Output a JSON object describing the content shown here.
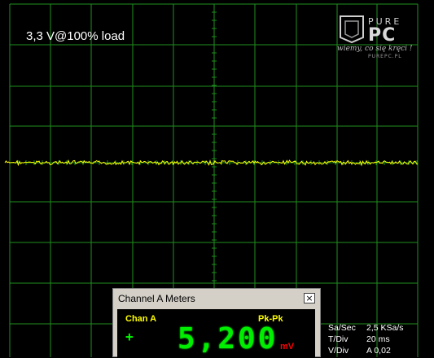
{
  "scope": {
    "grid_color": "#1f8f1f",
    "trace_color": "#ffff00",
    "background": "#000000",
    "overlay_label": "3,3 V@100% load"
  },
  "logo": {
    "word": "PURE",
    "brand": "PC",
    "slogan": "wiemy, co się kręci !",
    "url": "PUREPC.PL"
  },
  "meters": {
    "title": "Channel A Meters",
    "close_label": "×",
    "channel_label": "Chan A",
    "measurement": "Pk-Pk",
    "sign": "+",
    "reading": "5,200",
    "unit": "mV",
    "reading_color": "#00ee00",
    "label_color": "#ffff00",
    "unit_color": "#ff0000"
  },
  "settings": {
    "sa_sec_label": "Sa/Sec",
    "sa_sec_value": "2,5 KSa/s",
    "t_div_label": "T/Div",
    "t_div_value": "20 ms",
    "v_div_label": "V/Div",
    "v_div_value": "A 0,02"
  }
}
